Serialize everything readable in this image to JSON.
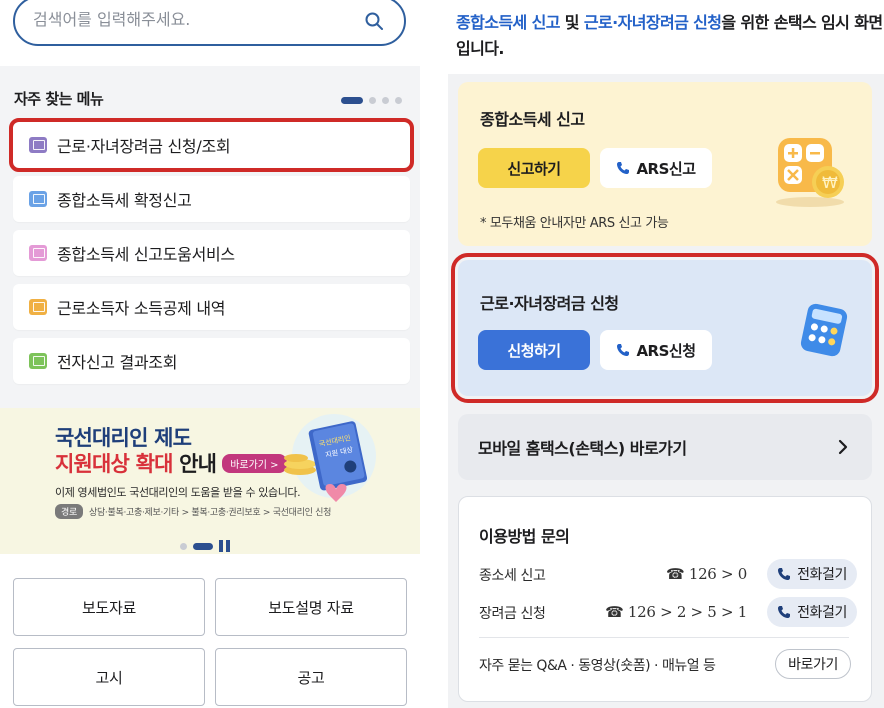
{
  "left": {
    "search": {
      "placeholder": "검색어를 입력해주세요."
    },
    "favorites": {
      "title": "자주 찾는 메뉴",
      "items": [
        {
          "label": "근로·자녀장려금 신청/조회",
          "icon_color": "#8e7bc4",
          "icon": "calendar-icon"
        },
        {
          "label": "종합소득세 확정신고",
          "icon_color": "#6aa2e6",
          "icon": "monitor-icon"
        },
        {
          "label": "종합소득세 신고도움서비스",
          "icon_color": "#e49ad6",
          "icon": "monitor-icon"
        },
        {
          "label": "근로소득자 소득공제 내역",
          "icon_color": "#f0b043",
          "icon": "monitor-icon"
        },
        {
          "label": "전자신고 결과조회",
          "icon_color": "#7dc35a",
          "icon": "monitor-icon"
        }
      ]
    },
    "banner": {
      "line1": "국선대리인 제도",
      "line2_red": "지원대상 확대",
      "line2_rest": " 안내",
      "button": "바로가기 >",
      "desc": "이제 영세법인도 국선대리인의 도움을 받을 수 있습니다.",
      "path_tag": "경로",
      "path": "상담·불복·고충·제보·기타 > 불복·고충·권리보호 > 국선대리인 신청",
      "art_text1": "국선대리인",
      "art_text2": "지원 대상"
    },
    "grid": {
      "press": "보도자료",
      "press_explain": "보도설명 자료",
      "notice": "고시",
      "announce": "공고"
    }
  },
  "right": {
    "notice": {
      "part1": "종합소득세 신고",
      "part2": " 및 ",
      "part3": "근로·자녀장려금 신청",
      "part4": "을 위한 손택스 임시 화면입니다."
    },
    "income_tax": {
      "title": "종합소득세 신고",
      "file_button": "신고하기",
      "ars_button": "ARS신고",
      "note": "* 모두채움 안내자만 ARS 신고 가능"
    },
    "eitc": {
      "title": "근로·자녀장려금 신청",
      "apply_button": "신청하기",
      "ars_button": "ARS신청"
    },
    "mobile": {
      "label": "모바일 홈택스(손택스) 바로가기"
    },
    "inquiry": {
      "title": "이용방법 문의",
      "rows": [
        {
          "label": "종소세 신고",
          "number": "☎ 126 > 0",
          "call": "전화걸기"
        },
        {
          "label": "장려금 신청",
          "number": "☎ 126 > 2 > 5 > 1",
          "call": "전화걸기"
        }
      ],
      "faq": "자주 묻는 Q&A · 동영상(숏폼) · 매뉴얼 등",
      "go": "바로가기"
    }
  }
}
